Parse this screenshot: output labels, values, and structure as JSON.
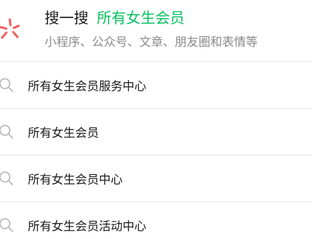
{
  "sou_yi_sou": {
    "title": "搜一搜",
    "keyword": "所有女生会员",
    "subtitle": "小程序、公众号、文章、朋友圈和表情等",
    "accent_color": "#07c160",
    "logo_color": "#f25d5d",
    "logo_icon": "sou-yi-sou-logo-icon"
  },
  "suggestions": [
    {
      "label": "所有女生会员服务中心",
      "icon": "search-icon"
    },
    {
      "label": "所有女生会员",
      "icon": "search-icon"
    },
    {
      "label": "所有女生会员中心",
      "icon": "search-icon"
    },
    {
      "label": "所有女生会员活动中心",
      "icon": "search-icon"
    }
  ]
}
